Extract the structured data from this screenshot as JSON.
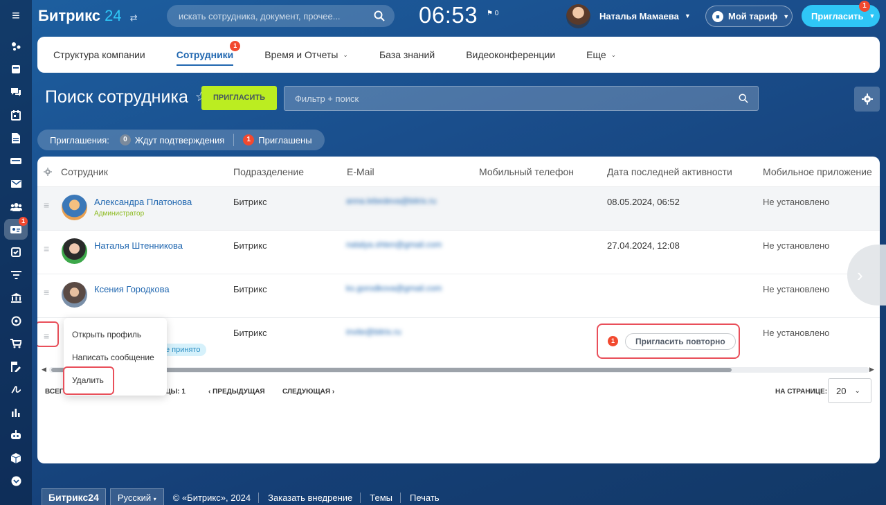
{
  "rail": {
    "items": [
      {
        "icon": "feed-icon"
      },
      {
        "icon": "tasks-icon"
      },
      {
        "icon": "chat-icon"
      },
      {
        "icon": "calendar-icon"
      },
      {
        "icon": "documents-icon"
      },
      {
        "icon": "drive-icon"
      },
      {
        "icon": "mail-icon"
      },
      {
        "icon": "groups-icon"
      },
      {
        "icon": "employees-icon",
        "badge": "1",
        "active": true
      },
      {
        "icon": "checklist-icon"
      },
      {
        "icon": "filter-icon"
      },
      {
        "icon": "bank-icon"
      },
      {
        "icon": "target-icon"
      },
      {
        "icon": "cart-icon"
      },
      {
        "icon": "sign-icon"
      },
      {
        "icon": "signature-icon"
      },
      {
        "icon": "analytics-icon"
      },
      {
        "icon": "robot-icon"
      },
      {
        "icon": "box-icon"
      },
      {
        "icon": "more-icon"
      }
    ]
  },
  "header": {
    "logo_text": "Битрикс",
    "logo_num": "24",
    "search_placeholder": "искать сотрудника, документ, прочее...",
    "clock": "06:53",
    "flag_count": "0",
    "user_name": "Наталья Мамаева",
    "tariff_label": "Мой тариф",
    "invite_label": "Пригласить",
    "invite_badge": "1"
  },
  "tabs": [
    {
      "label": "Структура компании"
    },
    {
      "label": "Сотрудники",
      "active": true,
      "badge": "1"
    },
    {
      "label": "Время и Отчеты",
      "chevron": true
    },
    {
      "label": "База знаний"
    },
    {
      "label": "Видеоконференции"
    },
    {
      "label": "Еще",
      "chevron": true
    }
  ],
  "page": {
    "title": "Поиск сотрудника",
    "invite_button": "ПРИГЛАСИТЬ",
    "filter_placeholder": "Фильтр + поиск"
  },
  "invitations": {
    "label": "Приглашения:",
    "pending_count": "0",
    "pending_label": "Ждут подтверждения",
    "invited_count": "1",
    "invited_label": "Приглашены"
  },
  "table": {
    "columns": [
      "Сотрудник",
      "Подразделение",
      "E-Mail",
      "Мобильный телефон",
      "Дата последней активности",
      "Мобильное приложение"
    ],
    "rows": [
      {
        "name": "Александра Платонова",
        "role": "Администратор",
        "department": "Битрикс",
        "email": "anna.lebedeva@bitrix.ru",
        "last_activity": "08.05.2024, 06:52",
        "app": "Не установлено"
      },
      {
        "name": "Наталья Штенникова",
        "department": "Битрикс",
        "email": "natalya.shten@gmail.com",
        "last_activity": "27.04.2024, 12:08",
        "app": "Не установлено"
      },
      {
        "name": "Ксения Городкова",
        "department": "Битрикс",
        "email": "ks.gorodkova@gmail.com",
        "last_activity": "",
        "app": "Не установлено"
      },
      {
        "name": "",
        "department": "Битрикс",
        "email": "invite@bitrix.ru",
        "status_tag": "е принято",
        "reinvite_badge": "1",
        "reinvite_label": "Пригласить повторно",
        "app": "Не установлено"
      }
    ]
  },
  "context_menu": {
    "items": [
      "Открыть профиль",
      "Написать сообщение",
      "Удалить"
    ]
  },
  "pager": {
    "total_prefix": "ВСЕГО",
    "page_fragment": "ИЦЫ: 1",
    "prev": "ПРЕДЫДУЩАЯ",
    "next": "СЛЕДУЮЩАЯ",
    "per_page_label": "НА СТРАНИЦЕ:",
    "per_page_value": "20"
  },
  "footer": {
    "brand": "Битрикс24",
    "language": "Русский",
    "copyright": "© «Битрикс», 2024",
    "order": "Заказать внедрение",
    "themes": "Темы",
    "print": "Печать"
  },
  "colors": {
    "accent_blue": "#2067b0",
    "invite_green": "#bbed21",
    "badge_red": "#f2492f",
    "highlight_red": "#e94f5a",
    "cyan": "#2fc6f6"
  }
}
